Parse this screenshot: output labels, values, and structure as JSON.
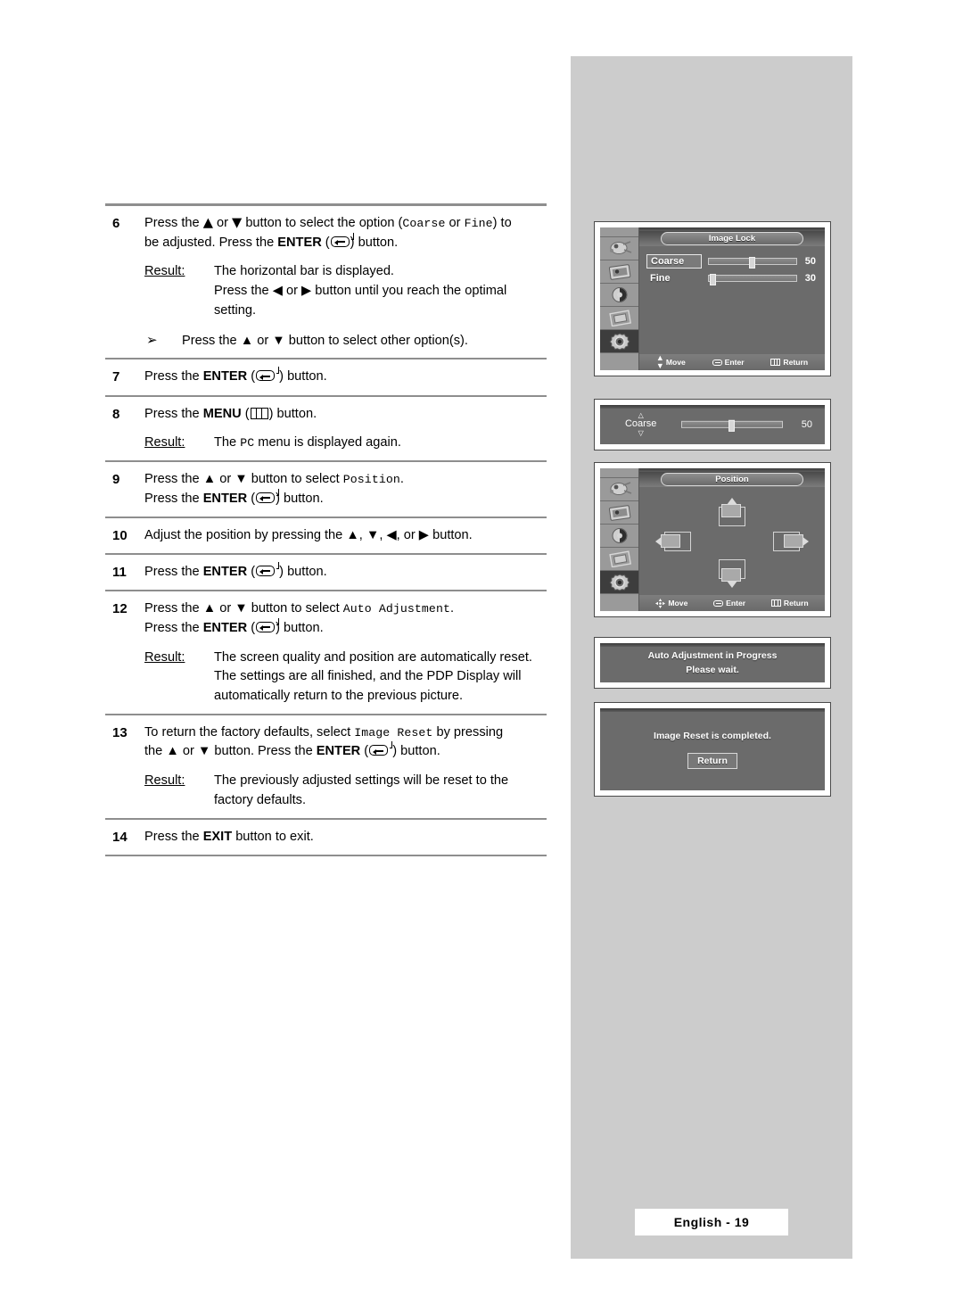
{
  "page": {
    "footer_label": "English - 19"
  },
  "steps": [
    {
      "num": "6",
      "lines": [
        {
          "type": "rich",
          "parts": [
            {
              "t": "Press the "
            },
            {
              "t": "▲",
              "style": "glyph"
            },
            {
              "t": " or "
            },
            {
              "t": "▼",
              "style": "glyph"
            },
            {
              "t": " button to select the option ("
            },
            {
              "t": "Coarse",
              "style": "mono"
            },
            {
              "t": " or "
            },
            {
              "t": "Fine",
              "style": "mono"
            },
            {
              "t": ") to"
            }
          ]
        },
        {
          "type": "rich",
          "parts": [
            {
              "t": "be adjusted. Press the "
            },
            {
              "t": "ENTER",
              "style": "bold"
            },
            {
              "t": " ("
            },
            {
              "t": "",
              "style": "enter-icon"
            },
            {
              "t": ") button."
            }
          ]
        }
      ],
      "result": {
        "label": "Result:",
        "lines": [
          "The horizontal bar is displayed.",
          "Press the ◀ or ▶ button until you reach the optimal",
          "setting."
        ]
      },
      "note": {
        "bullet": "➢",
        "text": "Press the ▲ or ▼ button to select other option(s)."
      }
    },
    {
      "num": "7",
      "lines": [
        {
          "type": "rich",
          "parts": [
            {
              "t": "Press the "
            },
            {
              "t": "ENTER",
              "style": "bold"
            },
            {
              "t": " ("
            },
            {
              "t": "",
              "style": "enter-icon"
            },
            {
              "t": " ) button."
            }
          ]
        }
      ]
    },
    {
      "num": "8",
      "lines": [
        {
          "type": "rich",
          "parts": [
            {
              "t": "Press the "
            },
            {
              "t": "MENU",
              "style": "bold"
            },
            {
              "t": " ("
            },
            {
              "t": "",
              "style": "menu-icon"
            },
            {
              "t": ") button."
            }
          ]
        }
      ],
      "result": {
        "label": "Result:",
        "lines_rich": [
          [
            {
              "t": "The "
            },
            {
              "t": "PC",
              "style": "mono"
            },
            {
              "t": "  menu is displayed again."
            }
          ]
        ]
      }
    },
    {
      "num": "9",
      "lines": [
        {
          "type": "rich",
          "parts": [
            {
              "t": "Press the ▲ or ▼ button to select "
            },
            {
              "t": "Position",
              "style": "mono"
            },
            {
              "t": "."
            }
          ]
        },
        {
          "type": "rich",
          "parts": [
            {
              "t": "Press the "
            },
            {
              "t": "ENTER",
              "style": "bold"
            },
            {
              "t": " ("
            },
            {
              "t": "",
              "style": "enter-icon"
            },
            {
              "t": ") button."
            }
          ]
        }
      ]
    },
    {
      "num": "10",
      "lines": [
        {
          "type": "rich",
          "parts": [
            {
              "t": "Adjust the position by pressing the ▲, ▼, ◀, or ▶ button."
            }
          ]
        }
      ]
    },
    {
      "num": "11",
      "lines": [
        {
          "type": "rich",
          "parts": [
            {
              "t": "Press the "
            },
            {
              "t": "ENTER",
              "style": "bold"
            },
            {
              "t": " ("
            },
            {
              "t": "",
              "style": "enter-icon"
            },
            {
              "t": " ) button."
            }
          ]
        }
      ]
    },
    {
      "num": "12",
      "lines": [
        {
          "type": "rich",
          "parts": [
            {
              "t": "Press the ▲ or ▼ button to select "
            },
            {
              "t": "Auto Adjustment",
              "style": "mono"
            },
            {
              "t": "."
            }
          ]
        },
        {
          "type": "rich",
          "parts": [
            {
              "t": "Press the "
            },
            {
              "t": "ENTER",
              "style": "bold"
            },
            {
              "t": " ("
            },
            {
              "t": "",
              "style": "enter-icon"
            },
            {
              "t": ") button."
            }
          ]
        }
      ],
      "result": {
        "label": "Result:",
        "lines": [
          "The screen quality and position are automatically reset.",
          "The settings are all finished, and the PDP Display will",
          "automatically return to the previous picture."
        ]
      }
    },
    {
      "num": "13",
      "lines": [
        {
          "type": "rich",
          "parts": [
            {
              "t": "To return the factory defaults, select "
            },
            {
              "t": "Image Reset",
              "style": "mono"
            },
            {
              "t": " by pressing"
            }
          ]
        },
        {
          "type": "rich",
          "parts": [
            {
              "t": "the ▲ or ▼ button. Press the "
            },
            {
              "t": "ENTER",
              "style": "bold"
            },
            {
              "t": " ("
            },
            {
              "t": "",
              "style": "enter-icon"
            },
            {
              "t": " ) button."
            }
          ]
        }
      ],
      "result": {
        "label": "Result:",
        "lines": [
          "The previously adjusted settings will be reset to the",
          "factory defaults."
        ]
      }
    },
    {
      "num": "14",
      "lines": [
        {
          "type": "rich",
          "parts": [
            {
              "t": "Press the "
            },
            {
              "t": "EXIT",
              "style": "bold"
            },
            {
              "t": " button to exit."
            }
          ]
        }
      ]
    }
  ],
  "osd": {
    "image_lock": {
      "title": "Image Lock",
      "rows": [
        {
          "label": "Coarse",
          "value": "50",
          "percent": 50,
          "selected": true
        },
        {
          "label": "Fine",
          "value": "30",
          "percent": 2,
          "selected": false
        }
      ],
      "footer": [
        {
          "icon": "updown-icon",
          "label": "Move"
        },
        {
          "icon": "enter-icon",
          "label": "Enter"
        },
        {
          "icon": "menu-icon",
          "label": "Return"
        }
      ],
      "sidebar_icons": [
        "input-icon",
        "picture-icon",
        "sound-icon",
        "screen-icon",
        "setup-icon"
      ]
    },
    "coarse_popup": {
      "label": "Coarse",
      "value": "50",
      "percent": 50
    },
    "position": {
      "title": "Position",
      "footer": [
        {
          "icon": "move-pad-icon",
          "label": "Move"
        },
        {
          "icon": "enter-icon",
          "label": "Enter"
        },
        {
          "icon": "menu-icon",
          "label": "Return"
        }
      ],
      "sidebar_icons": [
        "input-icon",
        "picture-icon",
        "sound-icon",
        "screen-icon",
        "setup-icon"
      ]
    },
    "auto_adjust_msg": {
      "line1": "Auto Adjustment in Progress",
      "line2": "Please wait."
    },
    "reset_msg": {
      "line1": "Image Reset is completed.",
      "button": "Return"
    }
  },
  "colors": {
    "panel_gray": "#cccccc",
    "osd_bg": "#6b6b6b",
    "osd_sidebar": "#9a9a9a",
    "rule": "#8e8e8e"
  }
}
